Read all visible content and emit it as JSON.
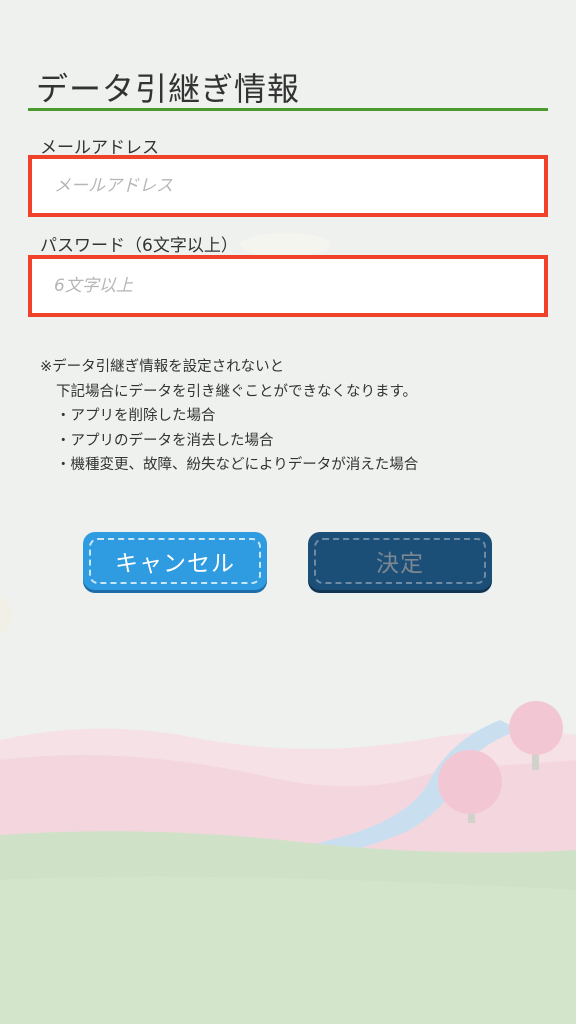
{
  "header": {
    "title": "データ引継ぎ情報"
  },
  "form": {
    "email": {
      "label": "メールアドレス",
      "placeholder": "メールアドレス",
      "value": ""
    },
    "password": {
      "label": "パスワード（6文字以上）",
      "placeholder": "6文字以上",
      "value": ""
    }
  },
  "notice": {
    "line1": "※データ引継ぎ情報を設定されないと",
    "line2": "下記場合にデータを引き継ぐことができなくなります。",
    "items": [
      "・アプリを削除した場合",
      "・アプリのデータを消去した場合",
      "・機種変更、故障、紛失などによりデータが消えた場合"
    ]
  },
  "buttons": {
    "cancel_label": "キャンセル",
    "confirm_label": "決定"
  },
  "colors": {
    "accent_rule": "#4a9a2e",
    "highlight_border": "#f0412b",
    "cancel_button": "#2f9be0",
    "confirm_button": "#1b4f78"
  }
}
